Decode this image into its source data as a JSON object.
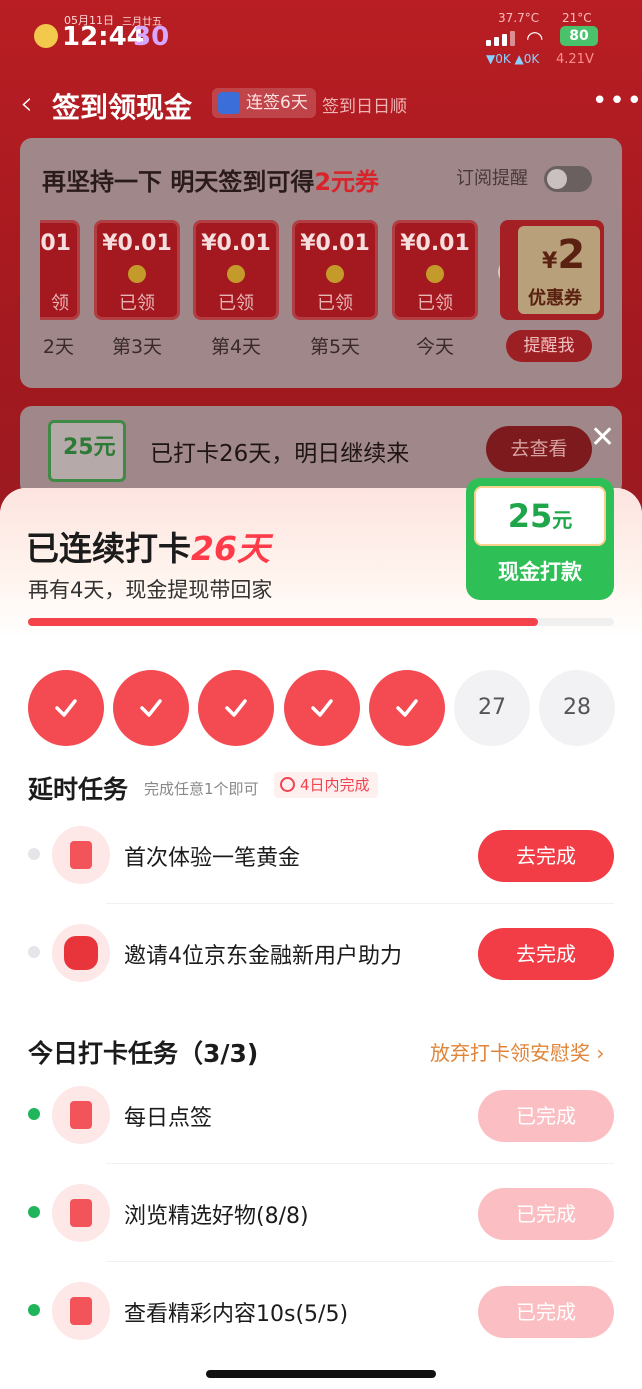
{
  "status_bar": {
    "date": "05月11日",
    "lunar": "三月廿五",
    "time": "12:44",
    "seconds": "30",
    "temp_cpu": "37.7°C",
    "temp_weather": "21°C",
    "battery": "80",
    "net_speed": "▼0K ▲0K",
    "voltage": "4.21V"
  },
  "nav": {
    "back": "‹",
    "title": "签到领现金",
    "streak_badge": "连签6天",
    "subtitle": "签到日日顺",
    "more": "•••"
  },
  "signin_card": {
    "title_prefix": "再坚持一下 明天签到可得",
    "title_highlight": "2元券",
    "remind_label": "订阅提醒",
    "days": [
      {
        "amount": "01",
        "status": "领",
        "label": "2天"
      },
      {
        "amount": "¥0.01",
        "status": "已领",
        "label": "第3天"
      },
      {
        "amount": "¥0.01",
        "status": "已领",
        "label": "第4天"
      },
      {
        "amount": "¥0.01",
        "status": "已领",
        "label": "第5天"
      },
      {
        "amount": "¥0.01",
        "status": "已领",
        "label": "今天"
      }
    ],
    "coupon_value": "2",
    "coupon_currency": "¥",
    "coupon_name": "优惠券",
    "remind_button": "提醒我"
  },
  "streak_card": {
    "icon_value": "25元",
    "text": "已打卡26天，明日继续来",
    "button": "去查看"
  },
  "sheet": {
    "title_prefix": "已连续打卡",
    "title_days": "26天",
    "subtitle": "再有4天，现金提现带回家",
    "progress": 0.87,
    "cash_value": "25",
    "cash_unit": "元",
    "cash_label": "现金打款",
    "checks": [
      {
        "state": "done",
        "label": ""
      },
      {
        "state": "done",
        "label": ""
      },
      {
        "state": "done",
        "label": ""
      },
      {
        "state": "done",
        "label": ""
      },
      {
        "state": "done",
        "label": ""
      },
      {
        "state": "todo",
        "label": "27"
      },
      {
        "state": "todo",
        "label": "28"
      }
    ]
  },
  "delayed_tasks": {
    "title": "延时任务",
    "hint": "完成任意1个即可",
    "badge": "4日内完成",
    "items": [
      {
        "name": "首次体验一笔黄金",
        "button": "去完成"
      },
      {
        "name": "邀请4位京东金融新用户助力",
        "button": "去完成"
      }
    ]
  },
  "daily_tasks": {
    "title": "今日打卡任务（3/3)",
    "link": "放弃打卡领安慰奖 ›",
    "items": [
      {
        "name": "每日点签",
        "button": "已完成"
      },
      {
        "name": "浏览精选好物(8/8)",
        "button": "已完成"
      },
      {
        "name": "查看精彩内容10s(5/5)",
        "button": "已完成"
      }
    ]
  },
  "colors": {
    "accent_red": "#f23c46",
    "done_pink": "#fbbfc3",
    "green": "#20b45b",
    "orange_link": "#e0853a"
  }
}
